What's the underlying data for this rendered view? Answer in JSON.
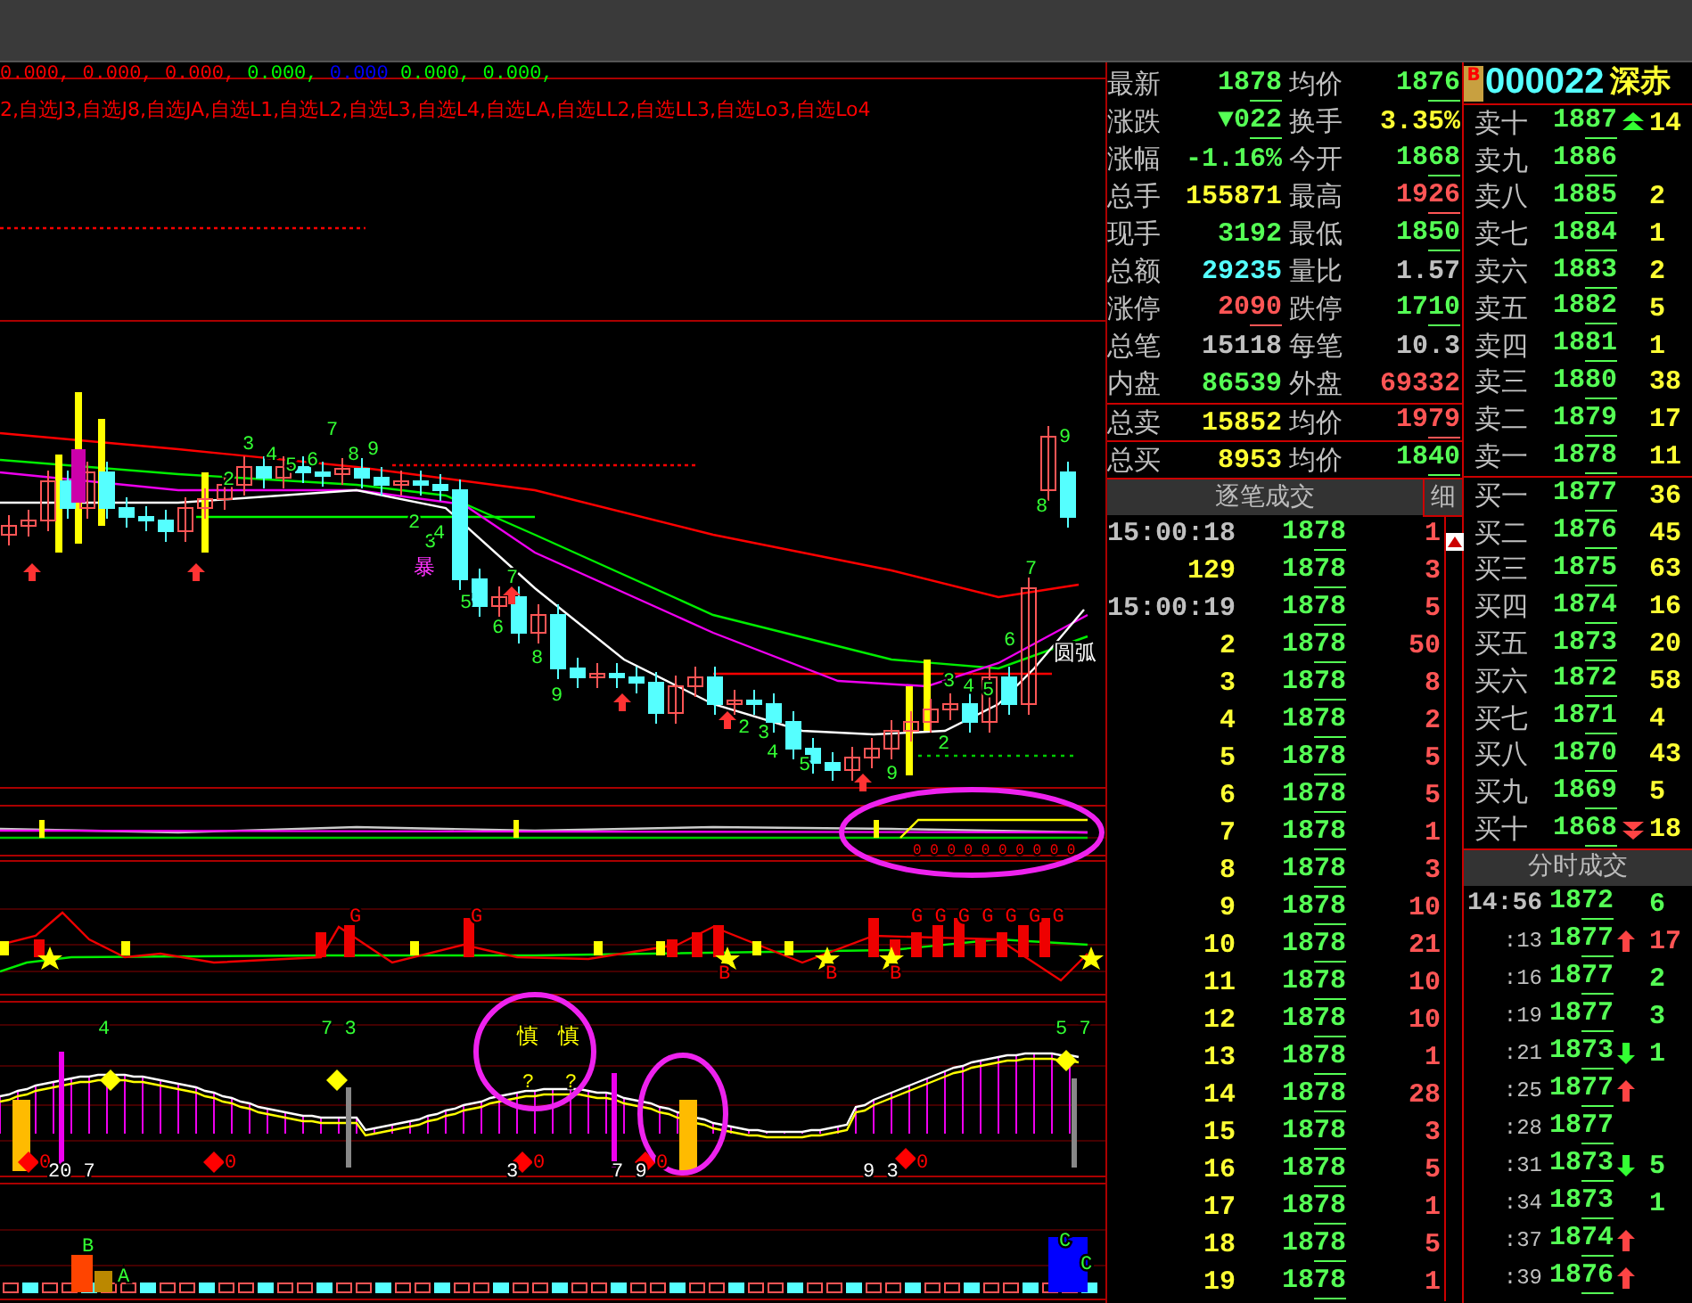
{
  "indicator_values": [
    {
      "text": "0.000,",
      "color": "#ff0000"
    },
    {
      "text": "0.000,",
      "color": "#ff0000"
    },
    {
      "text": "0.000,",
      "color": "#ff0000"
    },
    {
      "text": "0.000,",
      "color": "#00ff00"
    },
    {
      "text": "0.000",
      "color": "#0000ff"
    },
    {
      "text": "0.000,",
      "color": "#00ff00"
    },
    {
      "text": "0.000,",
      "color": "#00ff00"
    }
  ],
  "watchlist_line": "2,自选J3,自选J8,自选JA,自选L1,自选L2,自选L3,自选L4,自选LA,自选LL2,自选LL3,自选Lo3,自选Lo4",
  "chart_labels": [
    {
      "text": "2",
      "color": "#33ff33"
    },
    {
      "text": "3",
      "color": "#33ff33"
    },
    {
      "text": "4",
      "color": "#33ff33"
    },
    {
      "text": "5",
      "color": "#33ff33"
    },
    {
      "text": "6",
      "color": "#33ff33"
    },
    {
      "text": "7",
      "color": "#33ff33"
    },
    {
      "text": "8",
      "color": "#33ff33"
    },
    {
      "text": "9",
      "color": "#33ff33"
    },
    {
      "text": "2",
      "color": "#33ff33"
    },
    {
      "text": "3",
      "color": "#33ff33"
    },
    {
      "text": "4",
      "color": "#33ff33"
    },
    {
      "text": "暴",
      "color": "#ff33ff"
    },
    {
      "text": "5",
      "color": "#33ff33"
    },
    {
      "text": "6",
      "color": "#33ff33"
    },
    {
      "text": "7",
      "color": "#33ff33"
    },
    {
      "text": "8",
      "color": "#33ff33"
    },
    {
      "text": "9",
      "color": "#33ff33"
    },
    {
      "text": "2",
      "color": "#33ff33"
    },
    {
      "text": "3",
      "color": "#33ff33"
    },
    {
      "text": "4",
      "color": "#33ff33"
    },
    {
      "text": "5",
      "color": "#33ff33"
    },
    {
      "text": "9",
      "color": "#33ff33"
    },
    {
      "text": "2",
      "color": "#33ff33"
    },
    {
      "text": "3",
      "color": "#33ff33"
    },
    {
      "text": "4",
      "color": "#33ff33"
    },
    {
      "text": "5",
      "color": "#33ff33"
    },
    {
      "text": "6",
      "color": "#33ff33"
    },
    {
      "text": "7",
      "color": "#33ff33"
    },
    {
      "text": "8",
      "color": "#33ff33"
    },
    {
      "text": "9",
      "color": "#33ff33"
    },
    {
      "text": "圆弧",
      "color": "#ffffff"
    },
    {
      "text": "0 0 0 0 0 0 0 0 0 0",
      "color": "#ff0000"
    },
    {
      "text": "G",
      "color": "#ff0000"
    },
    {
      "text": "G",
      "color": "#ff0000"
    },
    {
      "text": "G G G G G G G",
      "color": "#ff0000"
    },
    {
      "text": "B",
      "color": "#ff0000"
    },
    {
      "text": "B",
      "color": "#ff0000"
    },
    {
      "text": "B",
      "color": "#ff0000"
    },
    {
      "text": "4",
      "color": "#33ff33"
    },
    {
      "text": "7 3",
      "color": "#33ff33"
    },
    {
      "text": "慎",
      "color": "#ffff00"
    },
    {
      "text": "慎",
      "color": "#ffff00"
    },
    {
      "text": "?",
      "color": "#ffff00"
    },
    {
      "text": "?",
      "color": "#ffff00"
    },
    {
      "text": "5 7",
      "color": "#33ff33"
    },
    {
      "text": "0",
      "color": "#ff0000"
    },
    {
      "text": "20 7",
      "color": "#ffffff"
    },
    {
      "text": "0",
      "color": "#ff0000"
    },
    {
      "text": "3",
      "color": "#ffffff"
    },
    {
      "text": "0",
      "color": "#ff0000"
    },
    {
      "text": "7 9",
      "color": "#ffffff"
    },
    {
      "text": "0",
      "color": "#ff0000"
    },
    {
      "text": "9 3",
      "color": "#ffffff"
    },
    {
      "text": "0",
      "color": "#ff0000"
    },
    {
      "text": "B",
      "color": "#33ff33"
    },
    {
      "text": "A",
      "color": "#33ff33"
    },
    {
      "text": "C",
      "color": "#33ff33"
    },
    {
      "text": "C",
      "color": "#33ff33"
    }
  ],
  "quote": {
    "rows": [
      {
        "cells": [
          {
            "label": "最新",
            "value": "1878",
            "color": "#55ff55",
            "underline": true
          },
          {
            "label": "均价",
            "value": "1876",
            "color": "#55ff55",
            "underline": true
          }
        ]
      },
      {
        "cells": [
          {
            "label": "涨跌",
            "value": "▼022",
            "color": "#55ff55",
            "underline": true
          },
          {
            "label": "换手",
            "value": "3.35%",
            "color": "#ffff33",
            "underline": false
          }
        ]
      },
      {
        "cells": [
          {
            "label": "涨幅",
            "value": "-1.16%",
            "color": "#55ff55",
            "underline": false
          },
          {
            "label": "今开",
            "value": "1868",
            "color": "#55ff55",
            "underline": true
          }
        ]
      },
      {
        "cells": [
          {
            "label": "总手",
            "value": "155871",
            "color": "#ffff33",
            "underline": false
          },
          {
            "label": "最高",
            "value": "1926",
            "color": "#ff5555",
            "underline": true
          }
        ]
      },
      {
        "cells": [
          {
            "label": "现手",
            "value": "3192",
            "color": "#55ff55",
            "underline": false
          },
          {
            "label": "最低",
            "value": "1850",
            "color": "#55ff55",
            "underline": true
          }
        ]
      },
      {
        "cells": [
          {
            "label": "总额",
            "value": "29235",
            "color": "#55ffff",
            "underline": false
          },
          {
            "label": "量比",
            "value": "1.57",
            "color": "#c0c0c0",
            "underline": false
          }
        ]
      },
      {
        "cells": [
          {
            "label": "涨停",
            "value": "2090",
            "color": "#ff5555",
            "underline": true
          },
          {
            "label": "跌停",
            "value": "1710",
            "color": "#55ff55",
            "underline": true
          }
        ]
      },
      {
        "cells": [
          {
            "label": "总笔",
            "value": "15118",
            "color": "#c0c0c0",
            "underline": false
          },
          {
            "label": "每笔",
            "value": "10.3",
            "color": "#c0c0c0",
            "underline": false
          }
        ]
      },
      {
        "cells": [
          {
            "label": "内盘",
            "value": "86539",
            "color": "#55ff55",
            "underline": false
          },
          {
            "label": "外盘",
            "value": "69332",
            "color": "#ff5555",
            "underline": false
          }
        ]
      },
      {
        "cells": [
          {
            "label": "总卖",
            "value": "15852",
            "color": "#ffff33",
            "underline": false
          },
          {
            "label": "均价",
            "value": "1979",
            "color": "#ff5555",
            "underline": true
          }
        ]
      },
      {
        "cells": [
          {
            "label": "总买",
            "value": "8953",
            "color": "#ffff33",
            "underline": false
          },
          {
            "label": "均价",
            "value": "1840",
            "color": "#55ff55",
            "underline": true
          }
        ]
      }
    ]
  },
  "ticks": {
    "title": "逐笔成交",
    "detail_button": "细",
    "rows": [
      {
        "kind": "time",
        "time": "15:00:18",
        "price": "1878",
        "volume": "1"
      },
      {
        "kind": "seq",
        "time": "129",
        "price": "1878",
        "volume": "3"
      },
      {
        "kind": "time",
        "time": "15:00:19",
        "price": "1878",
        "volume": "5"
      },
      {
        "kind": "seq",
        "time": "2",
        "price": "1878",
        "volume": "50"
      },
      {
        "kind": "seq",
        "time": "3",
        "price": "1878",
        "volume": "8"
      },
      {
        "kind": "seq",
        "time": "4",
        "price": "1878",
        "volume": "2"
      },
      {
        "kind": "seq",
        "time": "5",
        "price": "1878",
        "volume": "5"
      },
      {
        "kind": "seq",
        "time": "6",
        "price": "1878",
        "volume": "5"
      },
      {
        "kind": "seq",
        "time": "7",
        "price": "1878",
        "volume": "1"
      },
      {
        "kind": "seq",
        "time": "8",
        "price": "1878",
        "volume": "3"
      },
      {
        "kind": "seq",
        "time": "9",
        "price": "1878",
        "volume": "10"
      },
      {
        "kind": "seq",
        "time": "10",
        "price": "1878",
        "volume": "21"
      },
      {
        "kind": "seq",
        "time": "11",
        "price": "1878",
        "volume": "10"
      },
      {
        "kind": "seq",
        "time": "12",
        "price": "1878",
        "volume": "10"
      },
      {
        "kind": "seq",
        "time": "13",
        "price": "1878",
        "volume": "1"
      },
      {
        "kind": "seq",
        "time": "14",
        "price": "1878",
        "volume": "28"
      },
      {
        "kind": "seq",
        "time": "15",
        "price": "1878",
        "volume": "3"
      },
      {
        "kind": "seq",
        "time": "16",
        "price": "1878",
        "volume": "5"
      },
      {
        "kind": "seq",
        "time": "17",
        "price": "1878",
        "volume": "1"
      },
      {
        "kind": "seq",
        "time": "18",
        "price": "1878",
        "volume": "5"
      },
      {
        "kind": "seq",
        "time": "19",
        "price": "1878",
        "volume": "1"
      }
    ]
  },
  "stock": {
    "badge": "B",
    "code": "000022",
    "name": "深赤"
  },
  "order_book": {
    "asks": [
      {
        "label": "卖十",
        "price": "1887",
        "arrow_up": true,
        "arrow_down": false,
        "volume": "14"
      },
      {
        "label": "卖九",
        "price": "1886",
        "arrow_up": false,
        "arrow_down": false
      },
      {
        "label": "卖八",
        "price": "1885",
        "arrow_up": false,
        "arrow_down": false,
        "volume": "2"
      },
      {
        "label": "卖七",
        "price": "1884",
        "arrow_up": false,
        "arrow_down": false,
        "volume": "1"
      },
      {
        "label": "卖六",
        "price": "1883",
        "arrow_up": false,
        "arrow_down": false,
        "volume": "2"
      },
      {
        "label": "卖五",
        "price": "1882",
        "arrow_up": false,
        "arrow_down": false,
        "volume": "5"
      },
      {
        "label": "卖四",
        "price": "1881",
        "arrow_up": false,
        "arrow_down": false,
        "volume": "1"
      },
      {
        "label": "卖三",
        "price": "1880",
        "arrow_up": false,
        "arrow_down": false,
        "volume": "38"
      },
      {
        "label": "卖二",
        "price": "1879",
        "arrow_up": false,
        "arrow_down": false,
        "volume": "17"
      },
      {
        "label": "卖一",
        "price": "1878",
        "arrow_up": false,
        "arrow_down": false,
        "volume": "11"
      }
    ],
    "bids": [
      {
        "label": "买一",
        "price": "1877",
        "arrow_up": false,
        "arrow_down": false,
        "volume": "36"
      },
      {
        "label": "买二",
        "price": "1876",
        "arrow_up": false,
        "arrow_down": false,
        "volume": "45"
      },
      {
        "label": "买三",
        "price": "1875",
        "arrow_up": false,
        "arrow_down": false,
        "volume": "63"
      },
      {
        "label": "买四",
        "price": "1874",
        "arrow_up": false,
        "arrow_down": false,
        "volume": "16"
      },
      {
        "label": "买五",
        "price": "1873",
        "arrow_up": false,
        "arrow_down": false,
        "volume": "20"
      },
      {
        "label": "买六",
        "price": "1872",
        "arrow_up": false,
        "arrow_down": false,
        "volume": "58"
      },
      {
        "label": "买七",
        "price": "1871",
        "arrow_up": false,
        "arrow_down": false,
        "volume": "4"
      },
      {
        "label": "买八",
        "price": "1870",
        "arrow_up": false,
        "arrow_down": false,
        "volume": "43"
      },
      {
        "label": "买九",
        "price": "1869",
        "arrow_up": false,
        "arrow_down": false,
        "volume": "5"
      },
      {
        "label": "买十",
        "price": "1868",
        "arrow_up": false,
        "arrow_down": true,
        "volume": "18"
      }
    ]
  },
  "minute_trades": {
    "title": "分时成交",
    "rows": [
      {
        "kind": "full",
        "time": "14:56",
        "price": "1872",
        "arrow_up": false,
        "arrow_down": false,
        "volume": "6",
        "color": "#55ff55"
      },
      {
        "kind": "short",
        "time": ":13",
        "price": "1877",
        "arrow_up": true,
        "arrow_down": false,
        "volume": "17",
        "color": "#ff5555"
      },
      {
        "kind": "short",
        "time": ":16",
        "price": "1877",
        "arrow_up": false,
        "arrow_down": false,
        "volume": "2",
        "color": "#55ff55"
      },
      {
        "kind": "short",
        "time": ":19",
        "price": "1877",
        "arrow_up": false,
        "arrow_down": false,
        "volume": "3",
        "color": "#55ff55"
      },
      {
        "kind": "short",
        "time": ":21",
        "price": "1873",
        "arrow_up": false,
        "arrow_down": true,
        "volume": "1",
        "color": "#55ff55"
      },
      {
        "kind": "short",
        "time": ":25",
        "price": "1877",
        "arrow_up": true,
        "arrow_down": false
      },
      {
        "kind": "short",
        "time": ":28",
        "price": "1877",
        "arrow_up": false,
        "arrow_down": false
      },
      {
        "kind": "short",
        "time": ":31",
        "price": "1873",
        "arrow_up": false,
        "arrow_down": true,
        "volume": "5",
        "color": "#55ff55"
      },
      {
        "kind": "short",
        "time": ":34",
        "price": "1873",
        "arrow_up": false,
        "arrow_down": false,
        "volume": "1",
        "color": "#55ff55"
      },
      {
        "kind": "short",
        "time": ":37",
        "price": "1874",
        "arrow_up": true,
        "arrow_down": false
      },
      {
        "kind": "short",
        "time": ":39",
        "price": "1876",
        "arrow_up": true,
        "arrow_down": false
      }
    ]
  }
}
